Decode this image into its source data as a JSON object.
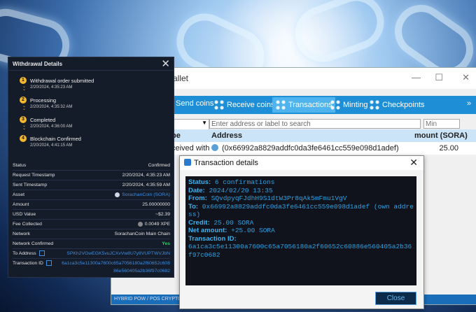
{
  "withdrawal": {
    "title": "Withdrawal Details",
    "steps": [
      {
        "num": "1",
        "label": "Withdrawal order submitted",
        "time": "2/20/2024, 4:35:23 AM"
      },
      {
        "num": "2",
        "label": "Processing",
        "time": "2/20/2024, 4:35:32 AM"
      },
      {
        "num": "3",
        "label": "Completed",
        "time": "2/20/2024, 4:36:00 AM"
      },
      {
        "num": "4",
        "label": "Blockchain Confirmed",
        "time": "2/20/2024, 4:41:15 AM"
      }
    ],
    "fields": {
      "status": {
        "k": "Status",
        "v": "Confirmed"
      },
      "request_ts": {
        "k": "Request Timestamp",
        "v": "2/20/2024, 4:35:23 AM"
      },
      "sent_ts": {
        "k": "Sent Timestamp",
        "v": "2/20/2024, 4:35:59 AM"
      },
      "asset": {
        "k": "Asset",
        "v": "SorachanCoin (SORA)"
      },
      "amount": {
        "k": "Amount",
        "v": "25.00000000"
      },
      "usd": {
        "k": "USD Value",
        "v": "~$2.39"
      },
      "fee": {
        "k": "Fee Collected",
        "v": "0.0049 XPE"
      },
      "network": {
        "k": "Network",
        "v": "SorachanCoin Main Chain"
      },
      "confirmed": {
        "k": "Network Confirmed",
        "v": "Yes"
      },
      "to_address": {
        "k": "To Address",
        "v": "SPKh2VGwEGK5vuJCXvVw8U7y8VUPTWVJbN"
      },
      "tx_id": {
        "k": "Transaction ID",
        "v1": "6a1ca3c5e11300a7600c65a7056180a2f60652c608",
        "v2": "86e560405a2b36f97c0682"
      }
    }
  },
  "wallet": {
    "title": "allet",
    "toolbar": {
      "send": "Send coins",
      "receive": "Receive coins",
      "transactions": "Transactions",
      "minting": "Minting",
      "checkpoints": "Checkpoints",
      "more": "»"
    },
    "filter_placeholder": "Enter address or label to search",
    "amount_placeholder": "Min amount",
    "columns": {
      "type": "pe",
      "address": "Address",
      "amount": "mount (SORA)"
    },
    "row": {
      "type": "ceived with",
      "address": "(0x66992a8829addfc0da3fe6461cc559e098d1adef)",
      "amount": "25.00"
    },
    "statusbar": "HYBRID POW / POS CRYPTOCURRENCY SORACH"
  },
  "txdialog": {
    "title": "Transaction details",
    "close_x": "✕",
    "status_label": "Status:",
    "status": "6 confirmations",
    "date_label": "Date:",
    "date": "2024/02/20 13:35",
    "from_label": "From:",
    "from": "SQvdpyqFJdhH9S1dtW3Pr8qAk5mFmu1VgV",
    "to_label": "To:",
    "to": "0x66992a8829addfc0da3fe6461cc559e098d1adef (own address)",
    "credit_label": "Credit:",
    "credit": "25.00 SORA",
    "net_label": "Net amount:",
    "net": "+25.00 SORA",
    "txid_label": "Transaction ID:",
    "txid": "6a1ca3c5e11300a7600c65a7056180a2f60652c60886e560405a2b36f97c0682",
    "close_button": "Close"
  }
}
